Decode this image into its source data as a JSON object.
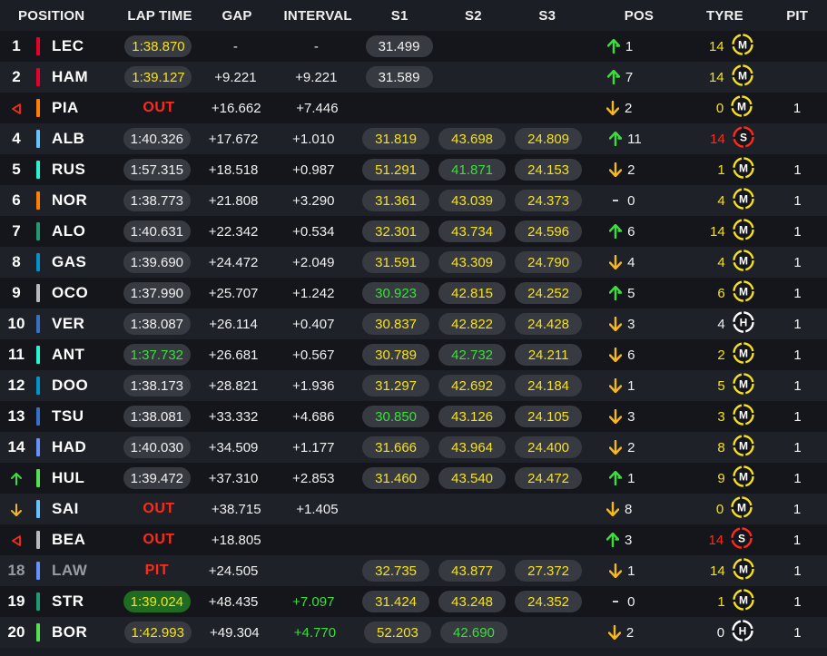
{
  "columns": {
    "position": "POSITION",
    "lap_time": "LAP TIME",
    "gap": "GAP",
    "interval": "INTERVAL",
    "s1": "S1",
    "s2": "S2",
    "s3": "S3",
    "pos": "POS",
    "tyre": "TYRE",
    "pit": "PIT"
  },
  "colors": {
    "yellow": "#f5e11f",
    "green": "#3adf3a",
    "red": "#ff2a1a",
    "medium_tyre": "#f5e11f",
    "soft_tyre": "#ff2a1a",
    "hard_tyre": "#ffffff"
  },
  "rows": [
    {
      "pos": "1",
      "pos_marker": "",
      "team_color": "#e8002d",
      "driver": "LEC",
      "lap": "1:38.870",
      "lap_color": "yellow",
      "lap_pill": "grey",
      "status": "",
      "gap": "-",
      "interval": "-",
      "interval_color": "white",
      "s1": "31.499",
      "s1_color": "white",
      "s2": "",
      "s2_color": "white",
      "s3": "",
      "s3_color": "white",
      "change_dir": "up",
      "change": "1",
      "tyre_age": "14",
      "age_color": "yellow",
      "compound": "M",
      "pit": ""
    },
    {
      "pos": "2",
      "pos_marker": "",
      "team_color": "#e8002d",
      "driver": "HAM",
      "lap": "1:39.127",
      "lap_color": "yellow",
      "lap_pill": "grey",
      "status": "",
      "gap": "+9.221",
      "interval": "+9.221",
      "interval_color": "white",
      "s1": "31.589",
      "s1_color": "white",
      "s2": "",
      "s2_color": "white",
      "s3": "",
      "s3_color": "white",
      "change_dir": "up",
      "change": "7",
      "tyre_age": "14",
      "age_color": "yellow",
      "compound": "M",
      "pit": ""
    },
    {
      "pos": "",
      "pos_marker": "retired",
      "team_color": "#ff8000",
      "driver": "PIA",
      "lap": "",
      "lap_color": "white",
      "lap_pill": "none",
      "status": "OUT",
      "gap": "+16.662",
      "interval": "+7.446",
      "interval_color": "white",
      "s1": "",
      "s1_color": "white",
      "s2": "",
      "s2_color": "white",
      "s3": "",
      "s3_color": "white",
      "change_dir": "down",
      "change": "2",
      "tyre_age": "0",
      "age_color": "yellow",
      "compound": "M",
      "pit": "1"
    },
    {
      "pos": "4",
      "pos_marker": "",
      "team_color": "#64c4ff",
      "driver": "ALB",
      "lap": "1:40.326",
      "lap_color": "white",
      "lap_pill": "grey",
      "status": "",
      "gap": "+17.672",
      "interval": "+1.010",
      "interval_color": "white",
      "s1": "31.819",
      "s1_color": "yellow",
      "s2": "43.698",
      "s2_color": "yellow",
      "s3": "24.809",
      "s3_color": "yellow",
      "change_dir": "up",
      "change": "11",
      "tyre_age": "14",
      "age_color": "red",
      "compound": "S",
      "pit": ""
    },
    {
      "pos": "5",
      "pos_marker": "",
      "team_color": "#27f4d2",
      "driver": "RUS",
      "lap": "1:57.315",
      "lap_color": "white",
      "lap_pill": "grey",
      "status": "",
      "gap": "+18.518",
      "interval": "+0.987",
      "interval_color": "white",
      "s1": "51.291",
      "s1_color": "yellow",
      "s2": "41.871",
      "s2_color": "green",
      "s3": "24.153",
      "s3_color": "yellow",
      "change_dir": "down",
      "change": "2",
      "tyre_age": "1",
      "age_color": "yellow",
      "compound": "M",
      "pit": "1"
    },
    {
      "pos": "6",
      "pos_marker": "",
      "team_color": "#ff8000",
      "driver": "NOR",
      "lap": "1:38.773",
      "lap_color": "white",
      "lap_pill": "grey",
      "status": "",
      "gap": "+21.808",
      "interval": "+3.290",
      "interval_color": "white",
      "s1": "31.361",
      "s1_color": "yellow",
      "s2": "43.039",
      "s2_color": "yellow",
      "s3": "24.373",
      "s3_color": "yellow",
      "change_dir": "none",
      "change": "0",
      "tyre_age": "4",
      "age_color": "yellow",
      "compound": "M",
      "pit": "1"
    },
    {
      "pos": "7",
      "pos_marker": "",
      "team_color": "#229971",
      "driver": "ALO",
      "lap": "1:40.631",
      "lap_color": "white",
      "lap_pill": "grey",
      "status": "",
      "gap": "+22.342",
      "interval": "+0.534",
      "interval_color": "white",
      "s1": "32.301",
      "s1_color": "yellow",
      "s2": "43.734",
      "s2_color": "yellow",
      "s3": "24.596",
      "s3_color": "yellow",
      "change_dir": "up",
      "change": "6",
      "tyre_age": "14",
      "age_color": "yellow",
      "compound": "M",
      "pit": "1"
    },
    {
      "pos": "8",
      "pos_marker": "",
      "team_color": "#0093cc",
      "driver": "GAS",
      "lap": "1:39.690",
      "lap_color": "white",
      "lap_pill": "grey",
      "status": "",
      "gap": "+24.472",
      "interval": "+2.049",
      "interval_color": "white",
      "s1": "31.591",
      "s1_color": "yellow",
      "s2": "43.309",
      "s2_color": "yellow",
      "s3": "24.790",
      "s3_color": "yellow",
      "change_dir": "down",
      "change": "4",
      "tyre_age": "4",
      "age_color": "yellow",
      "compound": "M",
      "pit": "1"
    },
    {
      "pos": "9",
      "pos_marker": "",
      "team_color": "#b6babd",
      "driver": "OCO",
      "lap": "1:37.990",
      "lap_color": "white",
      "lap_pill": "grey",
      "status": "",
      "gap": "+25.707",
      "interval": "+1.242",
      "interval_color": "white",
      "s1": "30.923",
      "s1_color": "green",
      "s2": "42.815",
      "s2_color": "yellow",
      "s3": "24.252",
      "s3_color": "yellow",
      "change_dir": "up",
      "change": "5",
      "tyre_age": "6",
      "age_color": "yellow",
      "compound": "M",
      "pit": "1"
    },
    {
      "pos": "10",
      "pos_marker": "",
      "team_color": "#3671c6",
      "driver": "VER",
      "lap": "1:38.087",
      "lap_color": "white",
      "lap_pill": "grey",
      "status": "",
      "gap": "+26.114",
      "interval": "+0.407",
      "interval_color": "white",
      "s1": "30.837",
      "s1_color": "yellow",
      "s2": "42.822",
      "s2_color": "yellow",
      "s3": "24.428",
      "s3_color": "yellow",
      "change_dir": "down",
      "change": "3",
      "tyre_age": "4",
      "age_color": "white",
      "compound": "H",
      "pit": "1"
    },
    {
      "pos": "11",
      "pos_marker": "",
      "team_color": "#27f4d2",
      "driver": "ANT",
      "lap": "1:37.732",
      "lap_color": "green",
      "lap_pill": "grey",
      "status": "",
      "gap": "+26.681",
      "interval": "+0.567",
      "interval_color": "white",
      "s1": "30.789",
      "s1_color": "yellow",
      "s2": "42.732",
      "s2_color": "green",
      "s3": "24.211",
      "s3_color": "yellow",
      "change_dir": "down",
      "change": "6",
      "tyre_age": "2",
      "age_color": "yellow",
      "compound": "M",
      "pit": "1"
    },
    {
      "pos": "12",
      "pos_marker": "",
      "team_color": "#0093cc",
      "driver": "DOO",
      "lap": "1:38.173",
      "lap_color": "white",
      "lap_pill": "grey",
      "status": "",
      "gap": "+28.821",
      "interval": "+1.936",
      "interval_color": "white",
      "s1": "31.297",
      "s1_color": "yellow",
      "s2": "42.692",
      "s2_color": "yellow",
      "s3": "24.184",
      "s3_color": "yellow",
      "change_dir": "down",
      "change": "1",
      "tyre_age": "5",
      "age_color": "yellow",
      "compound": "M",
      "pit": "1"
    },
    {
      "pos": "13",
      "pos_marker": "",
      "team_color": "#3671c6",
      "driver": "TSU",
      "lap": "1:38.081",
      "lap_color": "white",
      "lap_pill": "grey",
      "status": "",
      "gap": "+33.332",
      "interval": "+4.686",
      "interval_color": "white",
      "s1": "30.850",
      "s1_color": "green",
      "s2": "43.126",
      "s2_color": "yellow",
      "s3": "24.105",
      "s3_color": "yellow",
      "change_dir": "down",
      "change": "3",
      "tyre_age": "3",
      "age_color": "yellow",
      "compound": "M",
      "pit": "1"
    },
    {
      "pos": "14",
      "pos_marker": "",
      "team_color": "#6692ff",
      "driver": "HAD",
      "lap": "1:40.030",
      "lap_color": "white",
      "lap_pill": "grey",
      "status": "",
      "gap": "+34.509",
      "interval": "+1.177",
      "interval_color": "white",
      "s1": "31.666",
      "s1_color": "yellow",
      "s2": "43.964",
      "s2_color": "yellow",
      "s3": "24.400",
      "s3_color": "yellow",
      "change_dir": "down",
      "change": "2",
      "tyre_age": "8",
      "age_color": "yellow",
      "compound": "M",
      "pit": "1"
    },
    {
      "pos": "",
      "pos_marker": "up",
      "team_color": "#52e252",
      "driver": "HUL",
      "lap": "1:39.472",
      "lap_color": "white",
      "lap_pill": "grey",
      "status": "",
      "gap": "+37.310",
      "interval": "+2.853",
      "interval_color": "white",
      "s1": "31.460",
      "s1_color": "yellow",
      "s2": "43.540",
      "s2_color": "yellow",
      "s3": "24.472",
      "s3_color": "yellow",
      "change_dir": "up",
      "change": "1",
      "tyre_age": "9",
      "age_color": "yellow",
      "compound": "M",
      "pit": "1"
    },
    {
      "pos": "",
      "pos_marker": "down",
      "team_color": "#64c4ff",
      "driver": "SAI",
      "lap": "",
      "lap_color": "white",
      "lap_pill": "none",
      "status": "OUT",
      "gap": "+38.715",
      "interval": "+1.405",
      "interval_color": "white",
      "s1": "",
      "s1_color": "white",
      "s2": "",
      "s2_color": "white",
      "s3": "",
      "s3_color": "white",
      "change_dir": "down",
      "change": "8",
      "tyre_age": "0",
      "age_color": "yellow",
      "compound": "M",
      "pit": "1"
    },
    {
      "pos": "",
      "pos_marker": "retired",
      "team_color": "#b6babd",
      "driver": "BEA",
      "lap": "",
      "lap_color": "white",
      "lap_pill": "none",
      "status": "OUT",
      "gap": "+18.805",
      "interval": "",
      "interval_color": "white",
      "s1": "",
      "s1_color": "white",
      "s2": "",
      "s2_color": "white",
      "s3": "",
      "s3_color": "white",
      "change_dir": "up",
      "change": "3",
      "tyre_age": "14",
      "age_color": "red",
      "compound": "S",
      "pit": "1"
    },
    {
      "pos": "18",
      "pos_marker": "dim",
      "team_color": "#6692ff",
      "driver": "LAW",
      "lap": "",
      "lap_color": "white",
      "lap_pill": "none",
      "status": "PIT",
      "gap": "+24.505",
      "interval": "",
      "interval_color": "white",
      "s1": "32.735",
      "s1_color": "yellow",
      "s2": "43.877",
      "s2_color": "yellow",
      "s3": "27.372",
      "s3_color": "yellow",
      "change_dir": "down",
      "change": "1",
      "tyre_age": "14",
      "age_color": "yellow",
      "compound": "M",
      "pit": "1"
    },
    {
      "pos": "19",
      "pos_marker": "",
      "team_color": "#229971",
      "driver": "STR",
      "lap": "1:39.024",
      "lap_color": "yellow",
      "lap_pill": "green",
      "status": "",
      "gap": "+48.435",
      "interval": "+7.097",
      "interval_color": "green",
      "s1": "31.424",
      "s1_color": "yellow",
      "s2": "43.248",
      "s2_color": "yellow",
      "s3": "24.352",
      "s3_color": "yellow",
      "change_dir": "none",
      "change": "0",
      "tyre_age": "1",
      "age_color": "yellow",
      "compound": "M",
      "pit": "1"
    },
    {
      "pos": "20",
      "pos_marker": "",
      "team_color": "#52e252",
      "driver": "BOR",
      "lap": "1:42.993",
      "lap_color": "yellow",
      "lap_pill": "grey",
      "status": "",
      "gap": "+49.304",
      "interval": "+4.770",
      "interval_color": "green",
      "s1": "52.203",
      "s1_color": "yellow",
      "s2": "42.690",
      "s2_color": "green",
      "s3": "",
      "s3_color": "white",
      "change_dir": "down",
      "change": "2",
      "tyre_age": "0",
      "age_color": "white",
      "compound": "H",
      "pit": "1"
    }
  ]
}
